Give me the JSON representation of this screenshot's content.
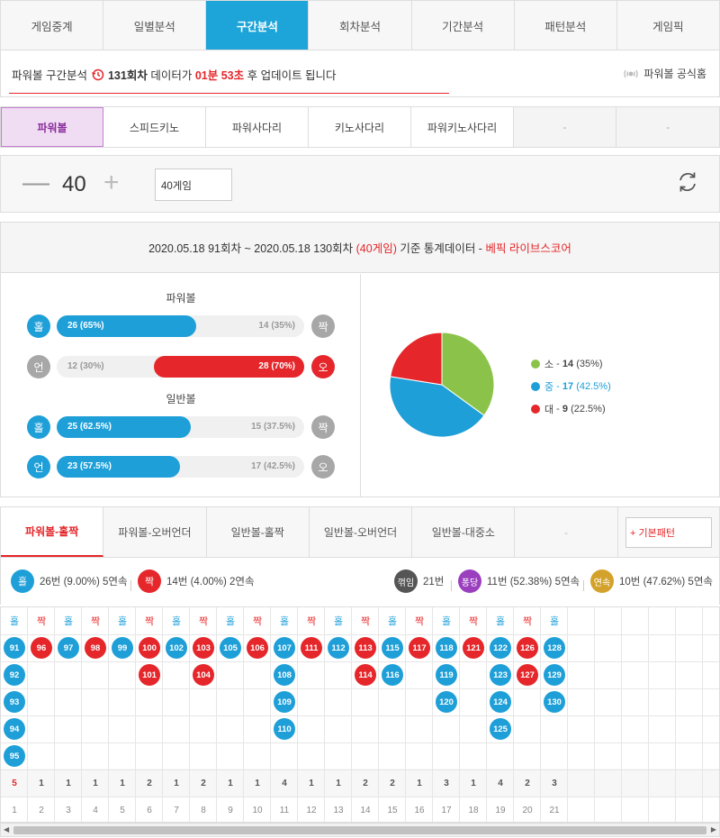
{
  "top_tabs": [
    "게임중계",
    "일별분석",
    "구간분석",
    "회차분석",
    "기간분석",
    "패턴분석",
    "게임픽"
  ],
  "top_tabs_active": 2,
  "notice": {
    "prefix": "파워볼 구간분석",
    "round": "131회차",
    "mid": "데이터가",
    "time": "01분 53초",
    "suffix": "후 업데이트 됩니다",
    "home_label": "파워볼 공식홈"
  },
  "games": [
    "파워볼",
    "스피드키노",
    "파워사다리",
    "키노사다리",
    "파워키노사다리",
    "-",
    "-"
  ],
  "counter": {
    "minus": "—",
    "value": "40",
    "plus": "+",
    "select": "40게임"
  },
  "stats_header": {
    "range": "2020.05.18 91회차 ~ 2020.05.18 130회차",
    "games": "(40게임)",
    "mid": "기준 통계데이터 -",
    "brand": "베픽 라이브스코어"
  },
  "powerball": {
    "title": "파워볼",
    "odd": {
      "left": "홀",
      "right": "짝",
      "left_label": "26 (65%)",
      "right_label": "14 (35%)",
      "left_pct": 65
    },
    "under": {
      "left": "언",
      "right": "오",
      "left_label": "12 (30%)",
      "right_label": "28 (70%)",
      "right_pct": 70
    }
  },
  "normalball": {
    "title": "일반볼",
    "odd": {
      "left": "홀",
      "right": "짝",
      "left_label": "25 (62.5%)",
      "right_label": "15 (37.5%)",
      "left_pct": 62.5
    },
    "under": {
      "left": "언",
      "right": "오",
      "left_label": "23 (57.5%)",
      "right_label": "17 (42.5%)",
      "left_pct": 57.5
    }
  },
  "chart_data": {
    "type": "pie",
    "categories": [
      "소",
      "중",
      "대"
    ],
    "values": [
      14,
      17,
      9
    ],
    "labels": [
      "소 - 14 (35%)",
      "중 - 17 (42.5%)",
      "대 - 9 (22.5%)"
    ],
    "colors": [
      "#8bc34a",
      "#1e9fd8",
      "#e5262a"
    ]
  },
  "legend": [
    {
      "name": "소",
      "sep": " - ",
      "value": "14",
      "pct": "(35%)",
      "color": "#8bc34a"
    },
    {
      "name": "중",
      "sep": " - ",
      "value": "17",
      "pct": "(42.5%)",
      "color": "#1e9fd8"
    },
    {
      "name": "대",
      "sep": " - ",
      "value": "9",
      "pct": "(22.5%)",
      "color": "#e5262a"
    }
  ],
  "pattern_tabs": [
    "파워볼-홀짝",
    "파워볼-오버언더",
    "일반볼-홀짝",
    "일반볼-오버언더",
    "일반볼-대중소",
    "-"
  ],
  "pattern_basic": "+ 기본패턴",
  "summary": {
    "odd": {
      "ball": "홀",
      "text": "26번 (9.00%) 5연속"
    },
    "even": {
      "ball": "짝",
      "text": "14번 (4.00%) 2연속"
    },
    "turn": {
      "ball": "꺾임",
      "text": "21번"
    },
    "pong": {
      "ball": "퐁당",
      "text": "11번 (52.38%) 5연속"
    },
    "streak": {
      "ball": "연속",
      "text": "10번 (47.62%) 5연속"
    }
  },
  "pattern": {
    "headers": [
      "홀",
      "짝",
      "홀",
      "짝",
      "홀",
      "짝",
      "홀",
      "짝",
      "홀",
      "짝",
      "홀",
      "짝",
      "홀",
      "짝",
      "홀",
      "짝",
      "홀",
      "짝",
      "홀",
      "짝",
      "홀"
    ],
    "columns": [
      [
        "91",
        "92",
        "93",
        "94",
        "95"
      ],
      [
        "96"
      ],
      [
        "97"
      ],
      [
        "98"
      ],
      [
        "99"
      ],
      [
        "100",
        "101"
      ],
      [
        "102"
      ],
      [
        "103",
        "104"
      ],
      [
        "105"
      ],
      [
        "106"
      ],
      [
        "107",
        "108",
        "109",
        "110"
      ],
      [
        "111"
      ],
      [
        "112"
      ],
      [
        "113",
        "114"
      ],
      [
        "115",
        "116"
      ],
      [
        "117"
      ],
      [
        "118",
        "119",
        "120"
      ],
      [
        "121"
      ],
      [
        "122",
        "123",
        "124",
        "125"
      ],
      [
        "126",
        "127"
      ],
      [
        "128",
        "129",
        "130"
      ]
    ],
    "counts": [
      "5",
      "1",
      "1",
      "1",
      "1",
      "2",
      "1",
      "2",
      "1",
      "1",
      "4",
      "1",
      "1",
      "2",
      "2",
      "1",
      "3",
      "1",
      "4",
      "2",
      "3"
    ],
    "indexes": [
      "1",
      "2",
      "3",
      "4",
      "5",
      "6",
      "7",
      "8",
      "9",
      "10",
      "11",
      "12",
      "13",
      "14",
      "15",
      "16",
      "17",
      "18",
      "19",
      "20",
      "21"
    ]
  },
  "colors": {
    "accent": "#1da4d9",
    "blue": "#1e9fd8",
    "red": "#e5262a",
    "purple": "#8b2e9e"
  }
}
